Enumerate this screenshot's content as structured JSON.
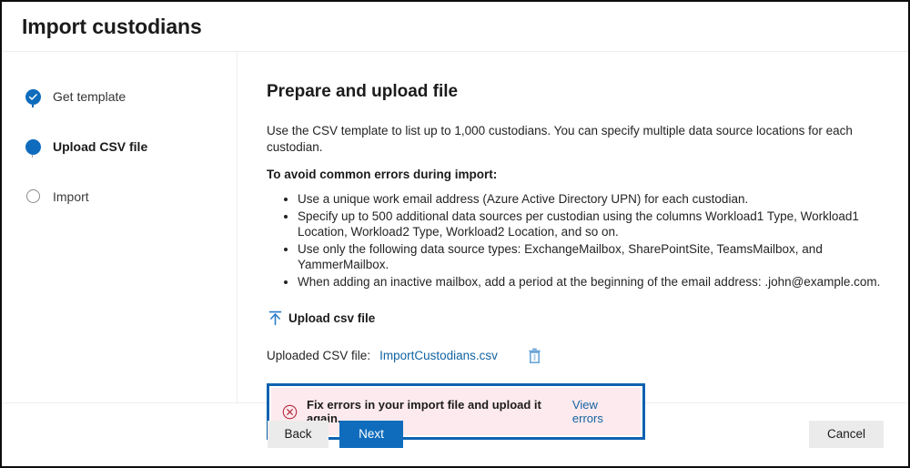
{
  "window": {
    "title": "Import custodians"
  },
  "stepper": {
    "steps": [
      {
        "label": "Get template",
        "state": "completed",
        "icon": "check-circle-icon"
      },
      {
        "label": "Upload CSV file",
        "state": "current",
        "icon": "filled-circle-icon"
      },
      {
        "label": "Import",
        "state": "upcoming",
        "icon": "empty-circle-icon"
      }
    ]
  },
  "main": {
    "title": "Prepare and upload file",
    "intro": "Use the CSV template to list up to 1,000 custodians. You can specify multiple data source locations for each custodian.",
    "subhead": "To avoid common errors during import:",
    "tips": [
      "Use a unique work email address (Azure Active Directory UPN) for each custodian.",
      "Specify up to 500 additional data sources per custodian using the columns Workload1 Type, Workload1 Location, Workload2 Type, Workload2 Location, and so on.",
      "Use only the following data source types: ExchangeMailbox, SharePointSite, TeamsMailbox, and YammerMailbox.",
      "When adding an inactive mailbox, add a period at the beginning of the email address: .john@example.com."
    ],
    "upload": {
      "link_label": "Upload csv file",
      "icon": "upload-arrow-icon"
    },
    "uploaded": {
      "label": "Uploaded CSV file:",
      "file_name": "ImportCustodians.csv",
      "delete_icon": "trash-icon"
    },
    "error": {
      "icon": "error-circle-x-icon",
      "message": "Fix errors in your import file and upload it again.",
      "link_label": "View errors"
    }
  },
  "footer": {
    "back_label": "Back",
    "next_label": "Next",
    "cancel_label": "Cancel"
  },
  "colors": {
    "accent_blue": "#0f6cbd",
    "link_blue": "#1264a3",
    "focus_blue": "#0f62b0",
    "error_bg": "#fdeaee",
    "error_red": "#b4293c",
    "step_gray": "#8a8a8a"
  }
}
